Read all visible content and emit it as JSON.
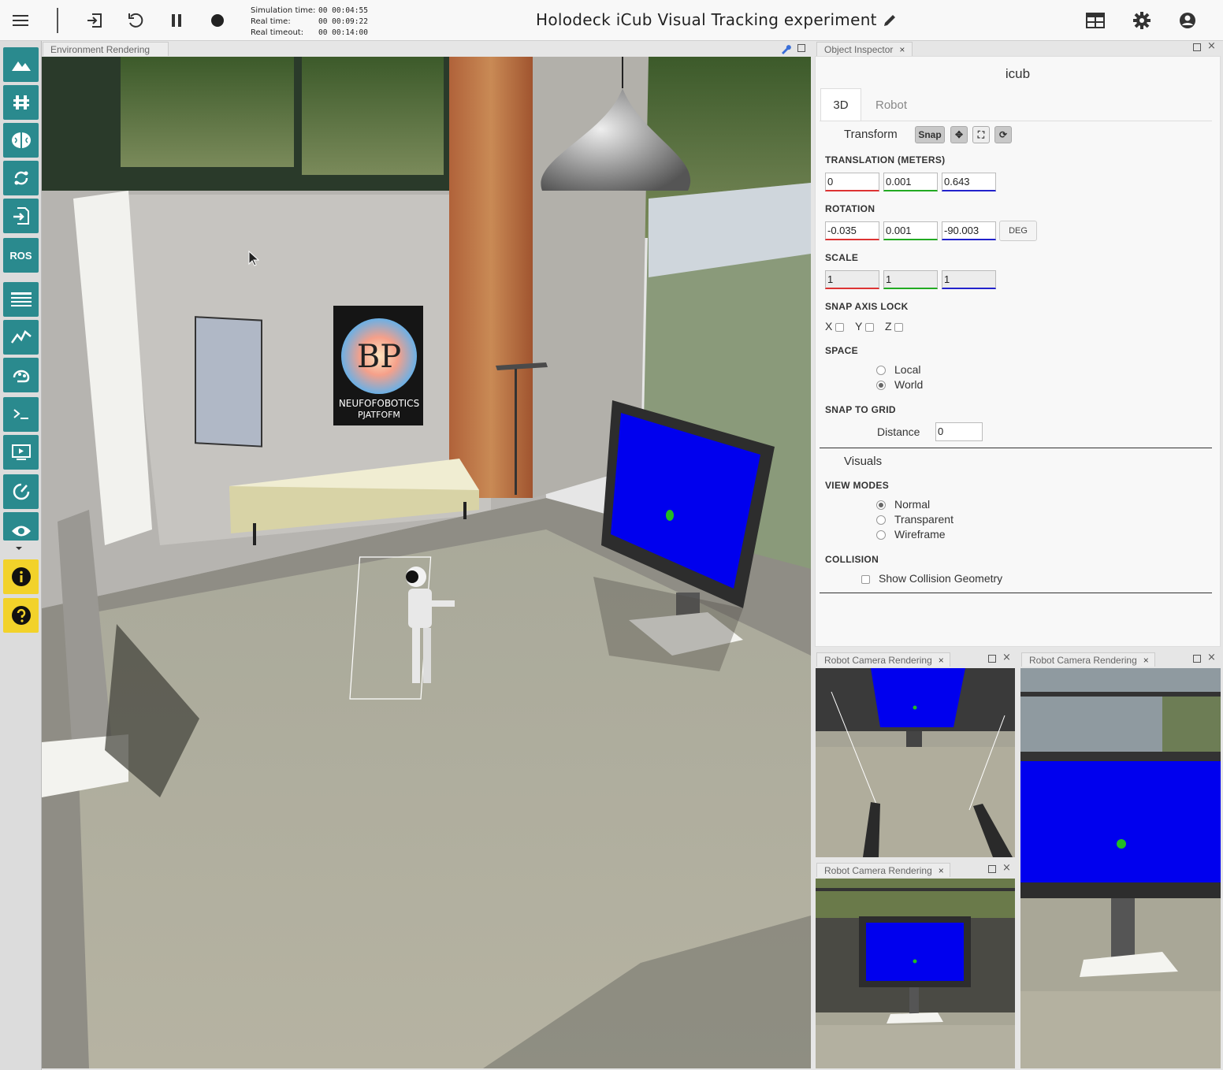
{
  "header": {
    "title": "Holodeck iCub Visual Tracking experiment",
    "sim_time_label": "Simulation time:",
    "sim_time": "00 00:04:55",
    "real_time_label": "Real time:",
    "real_time": "00 00:09:22",
    "real_timeout_label": "Real timeout:",
    "real_timeout": "00 00:14:00"
  },
  "sidebar": {
    "ros_label": "ROS"
  },
  "panels": {
    "environment_tab": "Environment Rendering",
    "inspector_tab": "Object Inspector",
    "camera_tab": "Robot Camera Rendering"
  },
  "inspector": {
    "object_name": "icub",
    "tabs": [
      "3D",
      "Robot"
    ],
    "transform_label": "Transform",
    "snap_label": "Snap",
    "translation_label": "TRANSLATION (METERS)",
    "translation": [
      "0",
      "0.001",
      "0.643"
    ],
    "rotation_label": "ROTATION",
    "rotation": [
      "-0.035",
      "0.001",
      "-90.003"
    ],
    "deg_label": "DEG",
    "scale_label": "SCALE",
    "scale": [
      "1",
      "1",
      "1"
    ],
    "snap_axis_label": "SNAP AXIS LOCK",
    "axes": [
      "X",
      "Y",
      "Z"
    ],
    "space_label": "SPACE",
    "space_options": [
      "Local",
      "World"
    ],
    "space_selected": "World",
    "snap_grid_label": "SNAP TO GRID",
    "distance_label": "Distance",
    "distance_value": "0",
    "visuals_label": "Visuals",
    "view_modes_label": "VIEW MODES",
    "view_modes": [
      "Normal",
      "Transparent",
      "Wireframe"
    ],
    "view_mode_selected": "Normal",
    "collision_label": "COLLISION",
    "collision_option": "Show Collision Geometry"
  },
  "poster": {
    "logo_letters": "BP",
    "caption_line1": "NEUFOFOBOTICS",
    "caption_line2": "PJATFOFM"
  },
  "colors": {
    "sidebar_button": "#2a8a8e",
    "help_button": "#f2d22a",
    "screen_blue": "#0000ee",
    "tracking_dot": "#22bb22"
  }
}
